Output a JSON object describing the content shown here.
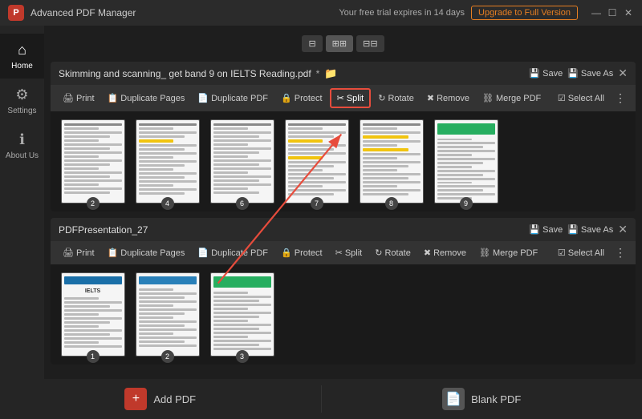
{
  "titleBar": {
    "appName": "Advanced PDF Manager",
    "trialText": "Your free trial expires in 14 days",
    "upgradeLabel": "Upgrade to Full Version",
    "windowControls": [
      "—",
      "☐",
      "✕"
    ]
  },
  "viewToolbar": {
    "buttons": [
      "⊞",
      "⊟",
      "⊠"
    ]
  },
  "sidebar": {
    "items": [
      {
        "id": "home",
        "label": "Home",
        "icon": "⌂",
        "active": true
      },
      {
        "id": "settings",
        "label": "Settings",
        "icon": "⚙"
      },
      {
        "id": "about",
        "label": "About Us",
        "icon": "ℹ"
      }
    ]
  },
  "pdf1": {
    "title": "Skimming and scanning_ get band 9 on IELTS Reading.pdf",
    "modified": true,
    "saveLabel": "Save",
    "saveAsLabel": "Save As",
    "toolbar": {
      "print": "Print",
      "duplicatePages": "Duplicate Pages",
      "duplicatePDF": "Duplicate PDF",
      "protect": "Protect",
      "split": "Split",
      "rotate": "Rotate",
      "remove": "Remove",
      "mergePDF": "Merge PDF",
      "selectAll": "Select All"
    },
    "pages": [
      {
        "num": 2,
        "type": "text"
      },
      {
        "num": 4,
        "type": "text"
      },
      {
        "num": 6,
        "type": "text"
      },
      {
        "num": 7,
        "type": "text"
      },
      {
        "num": 8,
        "type": "highlight"
      },
      {
        "num": 9,
        "type": "green"
      }
    ]
  },
  "pdf2": {
    "title": "PDFPresentation_27",
    "saveLabel": "Save",
    "saveAsLabel": "Save As",
    "toolbar": {
      "print": "Print",
      "duplicatePages": "Duplicate Pages",
      "duplicatePDF": "Duplicate PDF",
      "protect": "Protect",
      "split": "Split",
      "rotate": "Rotate",
      "remove": "Remove",
      "mergePDF": "Merge PDF",
      "selectAll": "Select All"
    },
    "pages": [
      {
        "num": 1,
        "type": "presentation"
      },
      {
        "num": 2,
        "type": "text"
      },
      {
        "num": 3,
        "type": "green"
      }
    ]
  },
  "bottomBar": {
    "addPDF": "Add PDF",
    "blankPDF": "Blank PDF"
  }
}
